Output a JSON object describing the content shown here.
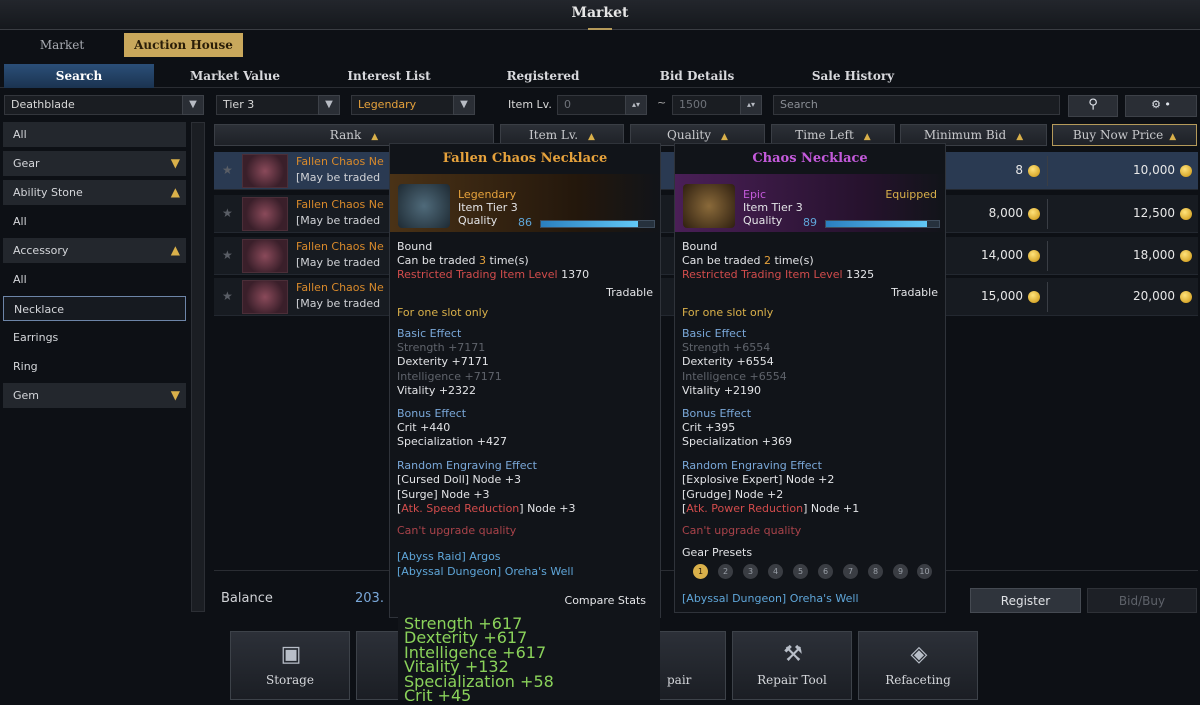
{
  "window": {
    "title": "Market"
  },
  "top_tabs": [
    "Market",
    "Auction House"
  ],
  "sub_tabs": [
    "Search",
    "Market Value",
    "Interest List",
    "Registered",
    "Bid Details",
    "Sale History"
  ],
  "filters": {
    "class": "Deathblade",
    "tier": "Tier 3",
    "grade": "Legendary",
    "item_lv_label": "Item Lv.",
    "item_lv_min": "0",
    "range_sep": "~",
    "item_lv_max": "1500",
    "search_placeholder": "Search"
  },
  "sidebar": [
    "All",
    "Gear",
    "Ability Stone",
    "All",
    "Accessory",
    "All",
    "Necklace",
    "Earrings",
    "Ring",
    "Gem"
  ],
  "columns": [
    "Rank",
    "Item Lv.",
    "Quality",
    "Time Left",
    "Minimum Bid",
    "Buy Now Price"
  ],
  "rows": [
    {
      "name": "Fallen Chaos Ne",
      "sub": "[May be traded ",
      "min_bid": "8",
      "buy_now": "10,000"
    },
    {
      "name": "Fallen Chaos Ne",
      "sub": "[May be traded ",
      "min_bid": "8,000",
      "buy_now": "12,500"
    },
    {
      "name": "Fallen Chaos Ne",
      "sub": "[May be traded ",
      "min_bid": "14,000",
      "buy_now": "18,000"
    },
    {
      "name": "Fallen Chaos Ne",
      "sub": "[May be traded ",
      "min_bid": "15,000",
      "buy_now": "20,000"
    }
  ],
  "balance": {
    "label": "Balance",
    "value": "203."
  },
  "tooltip_left": {
    "title": "Fallen Chaos Necklace",
    "grade": "Legendary",
    "tier": "Item Tier 3",
    "quality_label": "Quality",
    "quality": "86",
    "quality_fraction": 0.86,
    "bound": "Bound",
    "traded_pre": "Can be traded ",
    "traded_n": "3",
    "traded_post": " time(s)",
    "restricted_label": "Restricted Trading Item Level",
    "restricted_value": " 1370",
    "tradable": "Tradable",
    "slot": "For one slot only",
    "basic_label": "Basic Effect",
    "basic": [
      "Strength +7171",
      "Dexterity +7171",
      "Intelligence +7171",
      "Vitality +2322"
    ],
    "bonus_label": "Bonus Effect",
    "bonus": [
      "Crit +440",
      "Specialization +427"
    ],
    "engr_label": "Random Engraving Effect",
    "engr1_name": "[Cursed Doll]",
    "engr1_val": " Node +3",
    "engr2_name": "[Surge]",
    "engr2_val": " Node +3",
    "engr3_a": "[",
    "engr3_name": "Atk. Speed Reduction",
    "engr3_b": "]",
    "engr3_val": " Node +3",
    "cant": "Can't upgrade quality",
    "src1": "[Abyss Raid] Argos",
    "src2": "[Abyssal Dungeon] Oreha's Well",
    "compare_label": "Compare Stats",
    "compare": [
      "Strength +617",
      "Dexterity +617",
      "Intelligence +617",
      "Vitality +132",
      "Specialization +58",
      "Crit +45"
    ]
  },
  "tooltip_right": {
    "title": "Chaos Necklace",
    "grade": "Epic",
    "equipped": "Equipped",
    "tier": "Item Tier 3",
    "quality_label": "Quality",
    "quality": "89",
    "quality_fraction": 0.89,
    "bound": "Bound",
    "traded_pre": "Can be traded ",
    "traded_n": "2",
    "traded_post": " time(s)",
    "restricted_label": "Restricted Trading Item Level",
    "restricted_value": " 1325",
    "tradable": "Tradable",
    "slot": "For one slot only",
    "basic_label": "Basic Effect",
    "basic": [
      "Strength +6554",
      "Dexterity +6554",
      "Intelligence +6554",
      "Vitality +2190"
    ],
    "bonus_label": "Bonus Effect",
    "bonus": [
      "Crit +395",
      "Specialization +369"
    ],
    "engr_label": "Random Engraving Effect",
    "engr1_name": "[Explosive Expert]",
    "engr1_val": " Node +2",
    "engr2_name": "[Grudge]",
    "engr2_val": " Node +2",
    "engr3_a": "[",
    "engr3_name": "Atk. Power Reduction",
    "engr3_b": "]",
    "engr3_val": " Node +1",
    "cant": "Can't upgrade quality",
    "presets_label": "Gear Presets",
    "presets": [
      "1",
      "2",
      "3",
      "4",
      "5",
      "6",
      "7",
      "8",
      "9",
      "10"
    ],
    "src": "[Abyssal Dungeon] Oreha's Well"
  },
  "actions": {
    "register": "Register",
    "bid_buy": "Bid/Buy"
  },
  "bottom": [
    "Storage",
    "Repair",
    "Repair Tool",
    "Refaceting"
  ],
  "bottom_partial": "pair",
  "colors": {
    "legendary": "#e6a23c",
    "epic": "#c45adb",
    "accent": "#d9b04a"
  }
}
